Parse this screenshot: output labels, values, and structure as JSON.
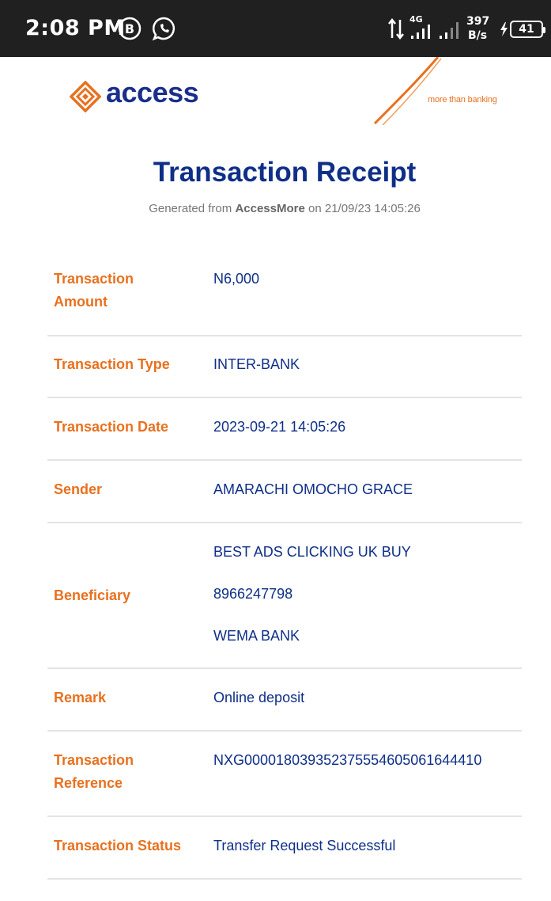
{
  "status_bar": {
    "time": "2:08 PM",
    "net_type": "4G",
    "net_speed_value": "397",
    "net_speed_unit": "B/s",
    "battery": "41",
    "notification_icons": [
      "b-badge-icon",
      "whatsapp-icon"
    ]
  },
  "banner": {
    "logo_text": "access",
    "tagline": "more than banking",
    "brand_colors": {
      "orange": "#e8711f",
      "navy": "#1a2f8a"
    }
  },
  "receipt": {
    "title": "Transaction Receipt",
    "subtitle_prefix": "Generated from",
    "subtitle_app": "AccessMore",
    "subtitle_suffix": "on 21/09/23 14:05:26"
  },
  "details": {
    "amount": {
      "label": "Transaction Amount",
      "value": "N6,000"
    },
    "type": {
      "label": "Transaction Type",
      "value": "INTER-BANK"
    },
    "date": {
      "label": "Transaction Date",
      "value": "2023-09-21 14:05:26"
    },
    "sender": {
      "label": "Sender",
      "value": "AMARACHI OMOCHO GRACE"
    },
    "beneficiary": {
      "label": "Beneficiary",
      "name": "BEST ADS CLICKING UK BUY",
      "account": "8966247798",
      "bank": "WEMA BANK"
    },
    "remark": {
      "label": "Remark",
      "value": "Online deposit"
    },
    "reference": {
      "label": "Transaction Reference",
      "value": "NXG000018039352375554605061644410"
    },
    "status": {
      "label": "Transaction Status",
      "value": "Transfer Request Successful"
    }
  }
}
